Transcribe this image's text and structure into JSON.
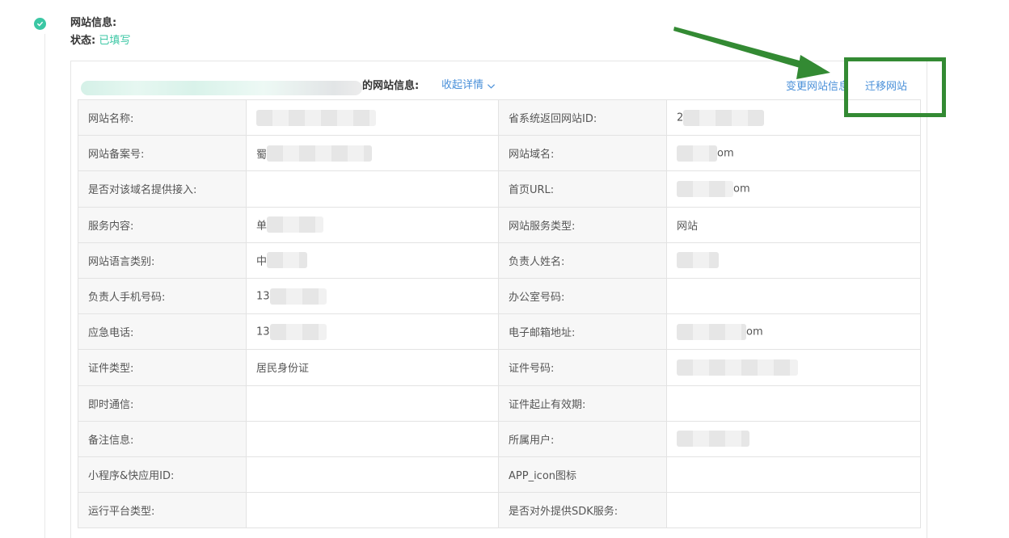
{
  "step": {
    "title": "网站信息:",
    "status_label": "状态:",
    "status_value": "已填写",
    "check_icon": "check-icon",
    "accent_color": "#3bc7a4"
  },
  "panel": {
    "site_info_label": "的网站信息:",
    "collapse_label": "收起详情",
    "change_label": "变更网站信息",
    "migrate_label": "迁移网站",
    "link_color": "#4a90d9"
  },
  "table": {
    "rows": [
      {
        "k1": "网站名称:",
        "v1": "",
        "k2": "省系统返回网站ID:",
        "v2": "2"
      },
      {
        "k1": "网站备案号:",
        "v1": "蜀",
        "k2": "网站域名:",
        "v2": "om"
      },
      {
        "k1": "是否对该域名提供接入:",
        "v1": "",
        "k2": "首页URL:",
        "v2": "om"
      },
      {
        "k1": "服务内容:",
        "v1": "单",
        "k2": "网站服务类型:",
        "v2": "网站"
      },
      {
        "k1": "网站语言类别:",
        "v1": "中",
        "k2": "负责人姓名:",
        "v2": ""
      },
      {
        "k1": "负责人手机号码:",
        "v1": "13",
        "k2": "办公室号码:",
        "v2": ""
      },
      {
        "k1": "应急电话:",
        "v1": "13",
        "k2": "电子邮箱地址:",
        "v2": "om"
      },
      {
        "k1": "证件类型:",
        "v1": "居民身份证",
        "k2": "证件号码:",
        "v2": ""
      },
      {
        "k1": "即时通信:",
        "v1": "",
        "k2": "证件起止有效期:",
        "v2": ""
      },
      {
        "k1": "备注信息:",
        "v1": "",
        "k2": "所属用户:",
        "v2": ""
      },
      {
        "k1": "小程序&快应用ID:",
        "v1": "",
        "k2": "APP_icon图标",
        "v2": ""
      },
      {
        "k1": "运行平台类型:",
        "v1": "",
        "k2": "是否对外提供SDK服务:",
        "v2": ""
      }
    ]
  },
  "annotation": {
    "arrow_color": "#338a33",
    "box_color": "#338a33"
  }
}
